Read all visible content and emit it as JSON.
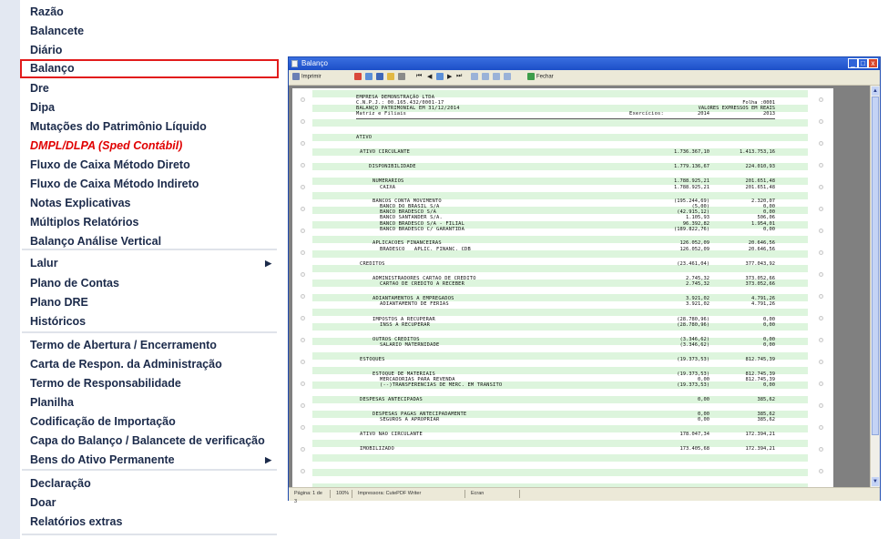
{
  "menu": {
    "items": [
      {
        "label": "Razão",
        "y": 0
      },
      {
        "label": "Balancete"
      },
      {
        "label": "Diário"
      },
      {
        "label": "Balanço",
        "selected": true
      },
      {
        "label": "Dre"
      },
      {
        "label": "Dipa"
      },
      {
        "label": "Mutações do Patrimônio Líquido"
      },
      {
        "label": "DMPL/DLPA (Sped Contábil)",
        "highlight": "red"
      },
      {
        "label": "Fluxo de Caixa Método Direto"
      },
      {
        "label": "Fluxo de Caixa Método Indireto"
      },
      {
        "label": "Notas Explicativas"
      },
      {
        "label": "Múltiplos Relatórios"
      },
      {
        "label": "Balanço Análise Vertical"
      },
      {
        "label": "Lalur",
        "submenu": true
      },
      {
        "label": "Plano de Contas"
      },
      {
        "label": "Plano DRE"
      },
      {
        "label": "Históricos"
      },
      {
        "label": "Termo de Abertura / Encerramento"
      },
      {
        "label": "Carta de Respon. da Administração"
      },
      {
        "label": "Termo de Responsabilidade"
      },
      {
        "label": "Planilha"
      },
      {
        "label": "Codificação de Importação"
      },
      {
        "label": "Capa do Balanço / Balancete de verificação"
      },
      {
        "label": "Bens do Ativo Permanente",
        "submenu": true
      },
      {
        "label": "Declaração"
      },
      {
        "label": "Doar"
      },
      {
        "label": "Relatórios extras"
      }
    ],
    "colors": {
      "text": "#1b2a4a",
      "selected_border": "#e21b1b",
      "red_item": "#e00000"
    }
  },
  "window": {
    "title": "Balanço",
    "toolbar": {
      "print_label": "Imprimir",
      "close_label": "Fechar"
    },
    "status": {
      "page": "Página: 1 de 3",
      "zoom": "100%",
      "printer": "Impressora: CutePDF Writer",
      "extra": "Ecran"
    }
  },
  "report": {
    "header": [
      "EMPRESA DEMONSTRAÇÃO LTDA",
      "C.N.P.J.: 00.165.432/0001-17",
      "BALANÇO PATRIMONIAL EM 31/12/2014",
      "Matriz e Filiais"
    ],
    "folha": "Folha :0001",
    "valores": "VALORES EXPRESSOS EM REAIS",
    "exercicios_label": "Exercícios:",
    "year1": "2014",
    "year2": "2013",
    "section": "ATIVO",
    "lines": [
      {
        "label": "ATIVO CIRCULANTE",
        "indent": 1,
        "v1": "1.736.367,10",
        "v2": "1.413.753,16"
      },
      {
        "label": "DISPONIBILIDADE",
        "indent": 2,
        "v1": "1.779.136,67",
        "v2": "224.010,93"
      },
      {
        "label": "NUMERARIOS",
        "indent": 3,
        "v1": "1.788.925,21",
        "v2": "201.651,48"
      },
      {
        "label": "CAIXA",
        "indent": 4,
        "v1": "1.788.925,21",
        "v2": "201.651,48"
      },
      {
        "label": "BANCOS CONTA MOVIMENTO",
        "indent": 3,
        "v1": "(195.244,69)",
        "v2": "2.320,07"
      },
      {
        "label": "BANCO DO BRASIL S/A",
        "indent": 4,
        "v1": "(5,00)",
        "v2": "0,00"
      },
      {
        "label": "BANCO BRADESCO S/A",
        "indent": 4,
        "v1": "(42.915,12)",
        "v2": "0,00"
      },
      {
        "label": "BANCO SANTANDER S/A.",
        "indent": 4,
        "v1": "1.105,93",
        "v2": "506,06"
      },
      {
        "label": "BANCO BRADESCO S/A - FILIAL",
        "indent": 4,
        "v1": "96.392,82",
        "v2": "1.954,01"
      },
      {
        "label": "BANCO BRADESCO C/ GARANTIDA",
        "indent": 4,
        "v1": "(189.822,76)",
        "v2": "0,00"
      },
      {
        "label": "APLICACOES FINANCEIRAS",
        "indent": 3,
        "v1": "126.052,09",
        "v2": "20.646,56"
      },
      {
        "label": "BRADESCO   APLIC. FINANC. CDB",
        "indent": 4,
        "v1": "126.052,09",
        "v2": "20.646,56"
      },
      {
        "label": "CREDITOS",
        "indent": 1,
        "v1": "(23.461,04)",
        "v2": "377.043,92"
      },
      {
        "label": "ADMINISTRADORES CARTAO DE CREDITO",
        "indent": 3,
        "v1": "2.745,32",
        "v2": "373.052,66"
      },
      {
        "label": "CARTAO DE CREDITO A RECEBER",
        "indent": 4,
        "v1": "2.745,32",
        "v2": "373.052,66"
      },
      {
        "label": "ADIANTAMENTOS A EMPREGADOS",
        "indent": 3,
        "v1": "3.921,02",
        "v2": "4.791,26"
      },
      {
        "label": "ADIANTAMENTO DE FERIAS",
        "indent": 4,
        "v1": "3.921,02",
        "v2": "4.791,26"
      },
      {
        "label": "IMPOSTOS A RECUPERAR",
        "indent": 3,
        "v1": "(28.780,96)",
        "v2": "0,00"
      },
      {
        "label": "INSS A RECUPERAR",
        "indent": 4,
        "v1": "(28.780,96)",
        "v2": "0,00"
      },
      {
        "label": "OUTROS CREDITOS",
        "indent": 3,
        "v1": "(3.346,62)",
        "v2": "0,00"
      },
      {
        "label": "SALARIO MATERNIDADE",
        "indent": 4,
        "v1": "(3.346,62)",
        "v2": "0,00"
      },
      {
        "label": "ESTOQUES",
        "indent": 1,
        "v1": "(19.373,53)",
        "v2": "812.745,39"
      },
      {
        "label": "ESTOQUE DE MATERIAIS",
        "indent": 3,
        "v1": "(19.373,53)",
        "v2": "812.745,39"
      },
      {
        "label": "MERCADORIAS PARA REVENDA",
        "indent": 4,
        "v1": "0,00",
        "v2": "812.745,39"
      },
      {
        "label": "(--)TRANSFERENCIAS DE MERC. EM TRANSITO",
        "indent": 4,
        "v1": "(19.373,53)",
        "v2": "0,00"
      },
      {
        "label": "DESPESAS ANTECIPADAS",
        "indent": 1,
        "v1": "0,00",
        "v2": "385,62"
      },
      {
        "label": "DESPESAS PAGAS ANTECIPADAMENTE",
        "indent": 3,
        "v1": "0,00",
        "v2": "385,62"
      },
      {
        "label": "SEGUROS A APROPRIAR",
        "indent": 4,
        "v1": "0,00",
        "v2": "385,62"
      },
      {
        "label": "ATIVO NAO CIRCULANTE",
        "indent": 1,
        "v1": "178.047,34",
        "v2": "172.394,21"
      },
      {
        "label": "IMOBILIZADO",
        "indent": 1,
        "v1": "173.405,68",
        "v2": "172.394,21"
      }
    ]
  }
}
